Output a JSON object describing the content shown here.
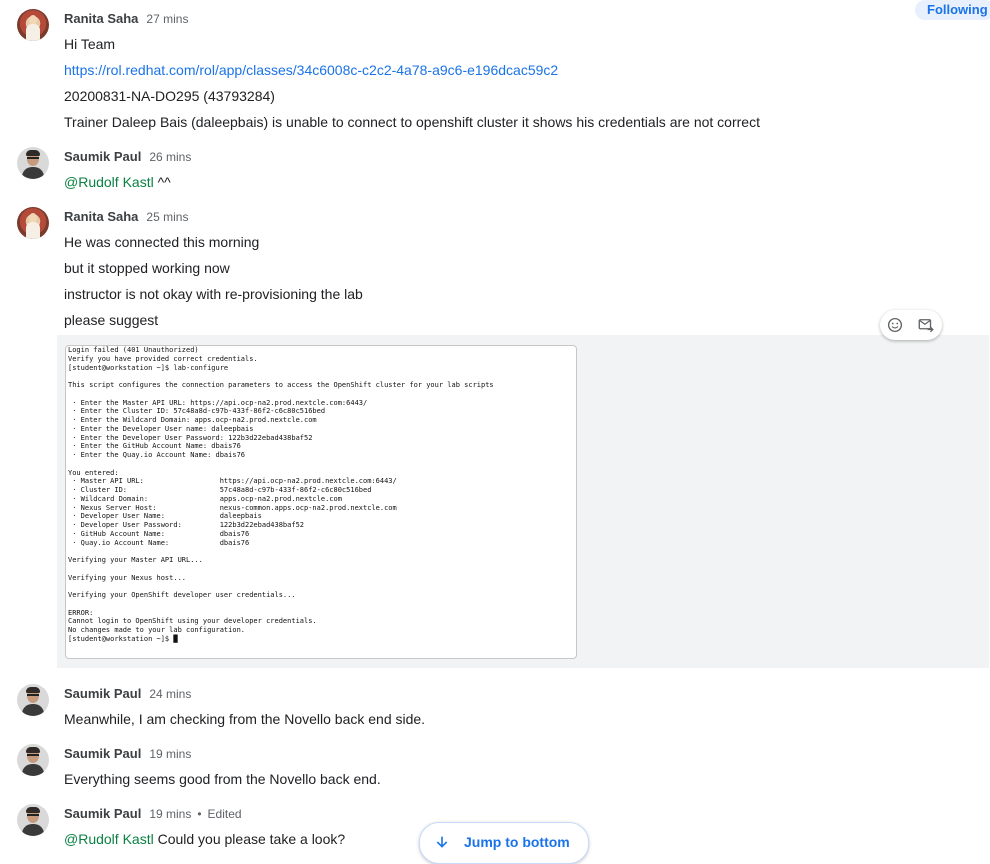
{
  "header": {
    "following_label": "Following"
  },
  "messages": [
    {
      "author": "Ranita Saha",
      "time": "27 mins",
      "lines": [
        "Hi Team",
        "https://rol.redhat.com/rol/app/classes/34c6008c-c2c2-4a78-a9c6-e196dcac59c2",
        "20200831-NA-DO295 (43793284)",
        "Trainer Daleep Bais (daleepbais) is unable to connect to openshift cluster it shows his credentials are not correct"
      ]
    },
    {
      "author": "Saumik Paul",
      "time": "26 mins",
      "mention": "@Rudolf Kastl",
      "text": " ^^"
    },
    {
      "author": "Ranita Saha",
      "time": "25 mins",
      "lines": [
        "He was connected this morning",
        "but it stopped working now",
        "instructor is not okay with re-provisioning the lab",
        "please suggest"
      ],
      "attachment_lines": [
        "Login failed (401 Unauthorized)",
        "Verify you have provided correct credentials.",
        "[student@workstation ~]$ lab-configure",
        "",
        "This script configures the connection parameters to access the OpenShift cluster for your lab scripts",
        "",
        " · Enter the Master API URL: https://api.ocp-na2.prod.nextcle.com:6443/",
        " · Enter the Cluster ID: 57c48a8d-c97b-433f-86f2-c6c80c516bed",
        " · Enter the Wildcard Domain: apps.ocp-na2.prod.nextcle.com",
        " · Enter the Developer User name: daleepbais",
        " · Enter the Developer User Password: 122b3d22ebad438baf52",
        " · Enter the GitHub Account Name: dbais76",
        " · Enter the Quay.io Account Name: dbais76",
        "",
        "You entered:",
        " · Master API URL:                  https://api.ocp-na2.prod.nextcle.com:6443/",
        " · Cluster ID:                      57c48a8d-c97b-433f-86f2-c6c80c516bed",
        " · Wildcard Domain:                 apps.ocp-na2.prod.nextcle.com",
        " · Nexus Server Host:               nexus-common.apps.ocp-na2.prod.nextcle.com",
        " · Developer User Name:             daleepbais",
        " · Developer User Password:         122b3d22ebad438baf52",
        " · GitHub Account Name:             dbais76",
        " · Quay.io Account Name:            dbais76",
        "",
        "Verifying your Master API URL...",
        "",
        "Verifying your Nexus host...",
        "",
        "Verifying your OpenShift developer user credentials...",
        "",
        "ERROR:",
        "Cannot login to OpenShift using your developer credentials.",
        "No changes made to your lab configuration.",
        "[student@workstation ~]$ █"
      ]
    },
    {
      "author": "Saumik Paul",
      "time": "24 mins",
      "text": "Meanwhile, I am checking from the Novello back end side."
    },
    {
      "author": "Saumik Paul",
      "time": "19 mins",
      "text": "Everything seems good from the Novello back end."
    },
    {
      "author": "Saumik Paul",
      "time": "19 mins",
      "edited": "Edited",
      "mention": "@Rudolf Kastl",
      "text": " Could you please take a look?"
    }
  ],
  "jump_button": {
    "label": "Jump to bottom"
  },
  "icons": {
    "emoji": "add-reaction-icon",
    "forward": "forward-to-inbox-icon",
    "arrow": "arrow-down-icon"
  },
  "colors": {
    "accent": "#1a73e8",
    "mention": "#0b8043",
    "attachment_bg": "#f1f3f4"
  }
}
